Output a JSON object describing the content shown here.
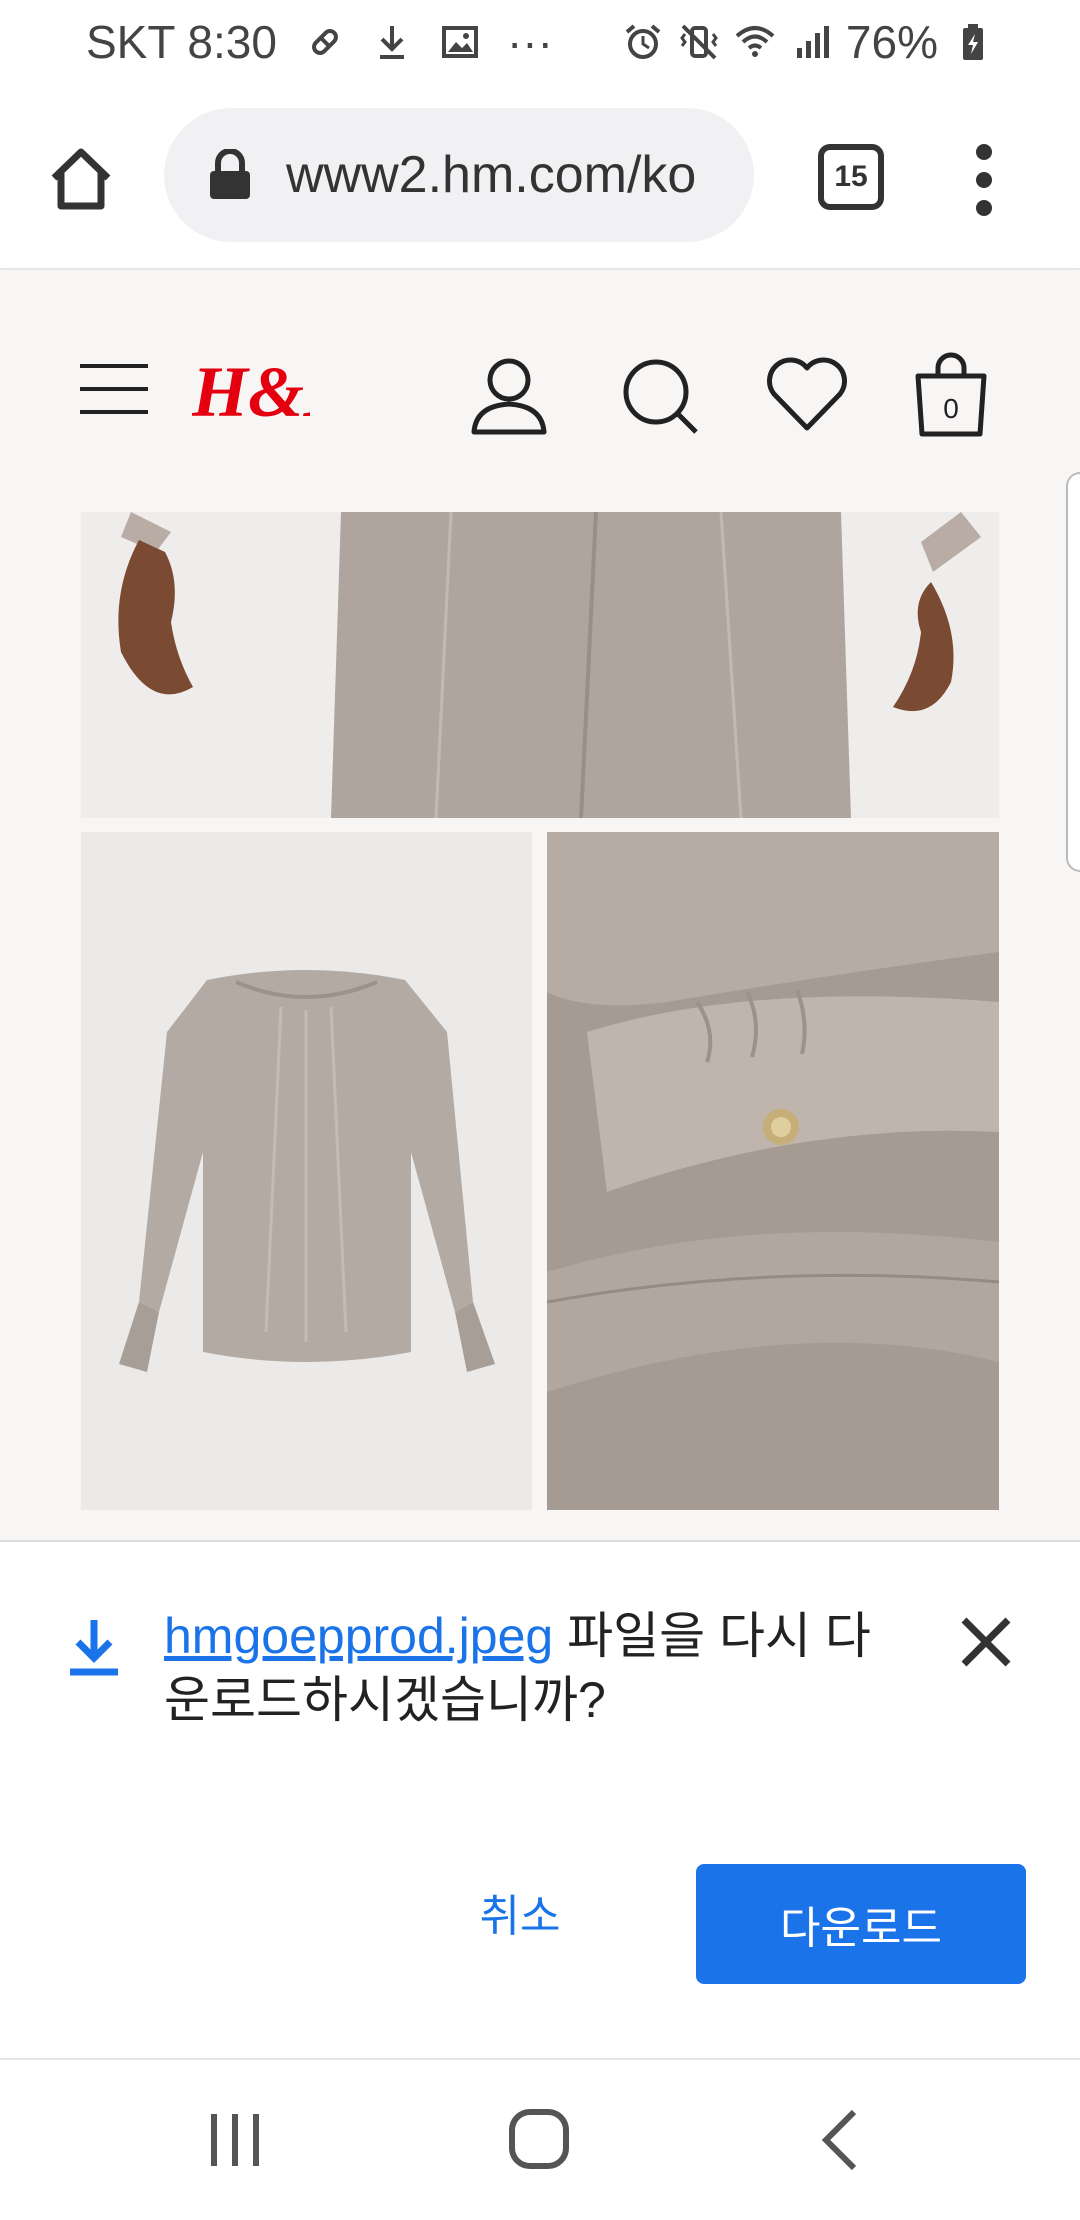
{
  "status_bar": {
    "carrier_time": "SKT 8:30",
    "more_notifications": "···",
    "battery": "76%"
  },
  "browser": {
    "url": "www2.hm.com/ko",
    "tab_count": "15"
  },
  "site": {
    "logo_text": "H&M",
    "cart_count": "0"
  },
  "download_prompt": {
    "filename": "hmgoepprod.jpeg",
    "message": " 파일을 다시 다운로드하시겠습니까?",
    "cancel_label": "취소",
    "download_label": "다운로드"
  },
  "colors": {
    "accent": "#1a73e8",
    "brand_red": "#e50010",
    "page_background": "#f8f6f5"
  }
}
